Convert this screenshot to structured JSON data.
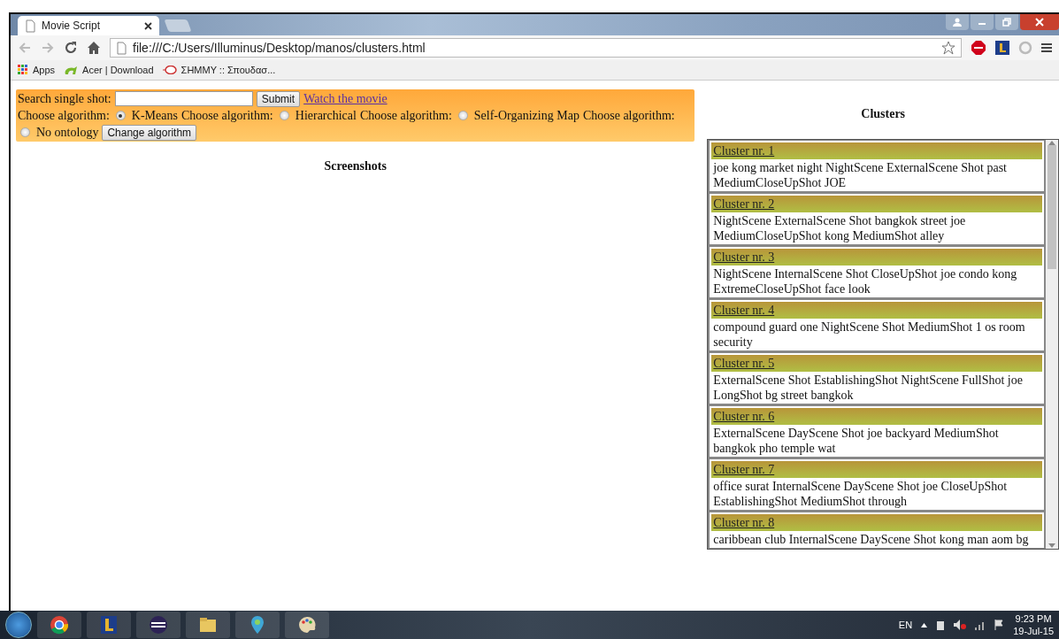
{
  "tabs": [
    {
      "title": "Movie Script",
      "selected": true
    }
  ],
  "address": "file:///C:/Users/Illuminus/Desktop/manos/clusters.html",
  "bookmarks": [
    {
      "label": "Apps",
      "kind": "apps"
    },
    {
      "label": "Acer | Download",
      "kind": "acer"
    },
    {
      "label": "ΣΗΜΜΥ :: Σπουδασ...",
      "kind": "school"
    }
  ],
  "search": {
    "label": "Search single shot:",
    "button": "Submit",
    "link": "Watch the movie"
  },
  "algorithms": [
    {
      "prefix": "Choose algorithm:",
      "label": "K-Means",
      "selected": true
    },
    {
      "prefix": "Choose algorithm:",
      "label": "Hierarchical",
      "selected": false
    },
    {
      "prefix": "Choose algorithm:",
      "label": "Self-Organizing Map",
      "selected": false
    },
    {
      "prefix": "Choose algorithm:",
      "label": "No ontology",
      "selected": false
    }
  ],
  "change_button": "Change algorithm",
  "screenshots_title": "Screenshots",
  "clusters_title": "Clusters",
  "clusters": [
    {
      "title": "Cluster nr. 1",
      "terms": "joe kong market night NightScene ExternalScene Shot past MediumCloseUpShot JOE"
    },
    {
      "title": "Cluster nr. 2",
      "terms": "NightScene ExternalScene Shot bangkok street joe MediumCloseUpShot kong MediumShot alley"
    },
    {
      "title": "Cluster nr. 3",
      "terms": "NightScene InternalScene Shot CloseUpShot joe condo kong ExtremeCloseUpShot face look"
    },
    {
      "title": "Cluster nr. 4",
      "terms": "compound guard one NightScene Shot MediumShot 1 os room security"
    },
    {
      "title": "Cluster nr. 5",
      "terms": "ExternalScene Shot EstablishingShot NightScene FullShot joe LongShot bg street bangkok"
    },
    {
      "title": "Cluster nr. 6",
      "terms": "ExternalScene DayScene Shot joe backyard MediumShot bangkok pho temple wat"
    },
    {
      "title": "Cluster nr. 7",
      "terms": "office surat InternalScene DayScene Shot joe CloseUpShot EstablishingShot MediumShot through"
    },
    {
      "title": "Cluster nr. 8",
      "terms": "caribbean club InternalScene DayScene Shot kong man aom bg"
    }
  ],
  "tray": {
    "language": "EN",
    "time": "9:23 PM",
    "date": "19-Jul-15"
  }
}
